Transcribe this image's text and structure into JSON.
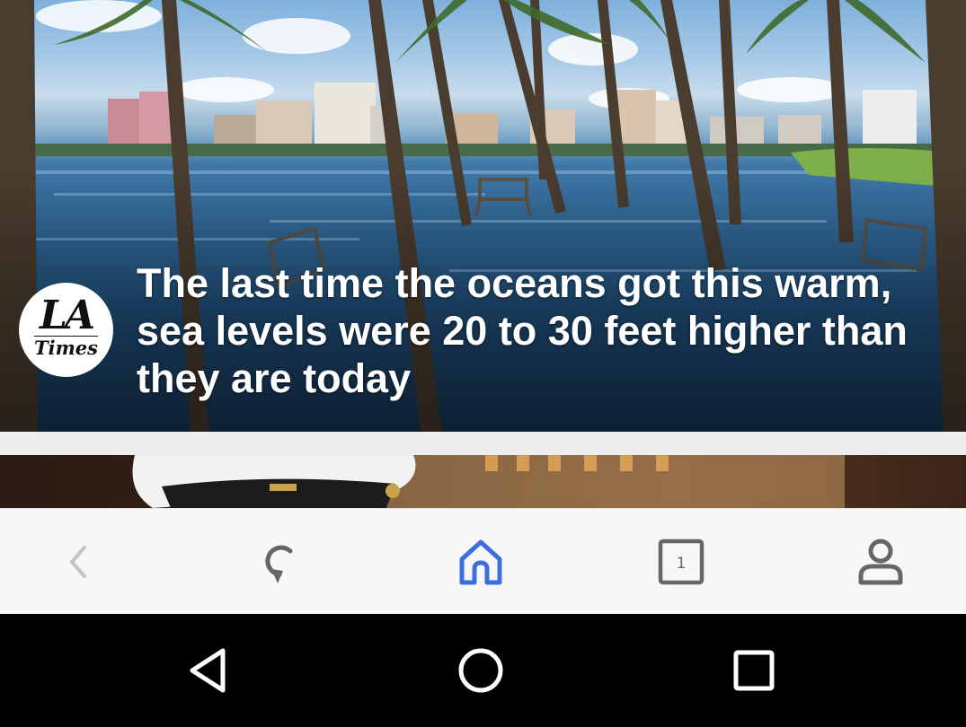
{
  "article": {
    "headline": "The last time the oceans got this warm, sea levels were 20 to 30 feet higher than they are today",
    "publisher": {
      "logo_line1": "LA",
      "logo_line2": "Times"
    },
    "image_icon": "flooded-palm-park-photo"
  },
  "next_article": {
    "image_icon": "naval-officer-cap-photo"
  },
  "browser_toolbar": {
    "back_icon": "chevron-left-icon",
    "refresh_icon": "refresh-icon",
    "home_icon": "home-icon",
    "tabs_icon": "tabs-icon",
    "tab_count": "1",
    "profile_icon": "person-icon",
    "active_color": "#3b6fe0",
    "icon_color": "#666666",
    "disabled_color": "#c4c4c4"
  },
  "system_nav": {
    "back_icon": "triangle-back-icon",
    "home_icon": "circle-home-icon",
    "recents_icon": "square-recents-icon"
  }
}
